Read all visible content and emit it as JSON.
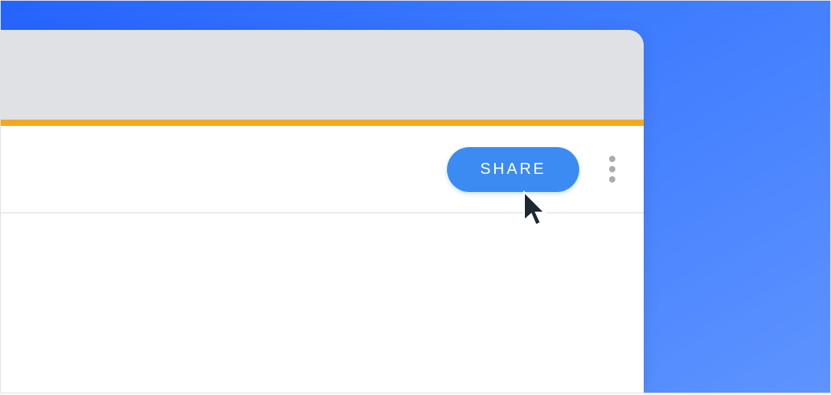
{
  "toolbar": {
    "share_label": "SHARE"
  },
  "colors": {
    "background_gradient_start": "#2563ff",
    "background_gradient_end": "#5e93ff",
    "titlebar_bg": "#dfe1e5",
    "accent_line": "#f5a623",
    "share_button_bg": "#3b8bf3",
    "more_dots": "#a8acb3"
  }
}
